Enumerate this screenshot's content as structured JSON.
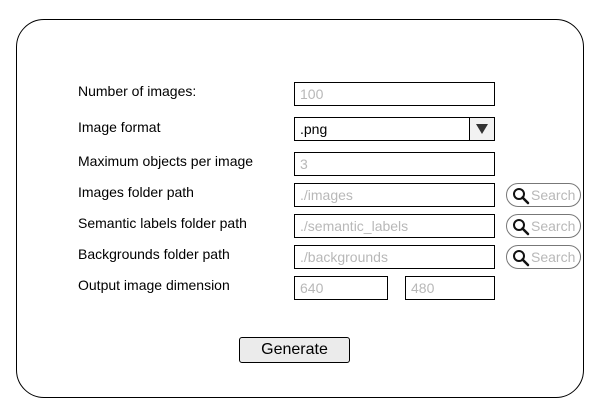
{
  "form": {
    "num_images": {
      "label": "Number of images:",
      "placeholder": "100"
    },
    "image_format": {
      "label": "Image format",
      "value": ".png"
    },
    "max_objects": {
      "label": "Maximum objects per image",
      "placeholder": "3"
    },
    "images_folder": {
      "label": "Images folder path",
      "placeholder": "./images",
      "search_label": "Search"
    },
    "semantic_folder": {
      "label": "Semantic labels folder path",
      "placeholder": "./semantic_labels",
      "search_label": "Search"
    },
    "backgrounds_folder": {
      "label": "Backgrounds folder path",
      "placeholder": "./backgrounds",
      "search_label": "Search"
    },
    "output_dimension": {
      "label": "Output image dimension",
      "width_placeholder": "640",
      "height_placeholder": "480"
    }
  },
  "actions": {
    "generate_label": "Generate"
  },
  "icons": {
    "dropdown": "triangle-down-icon",
    "search": "magnifier-icon"
  }
}
